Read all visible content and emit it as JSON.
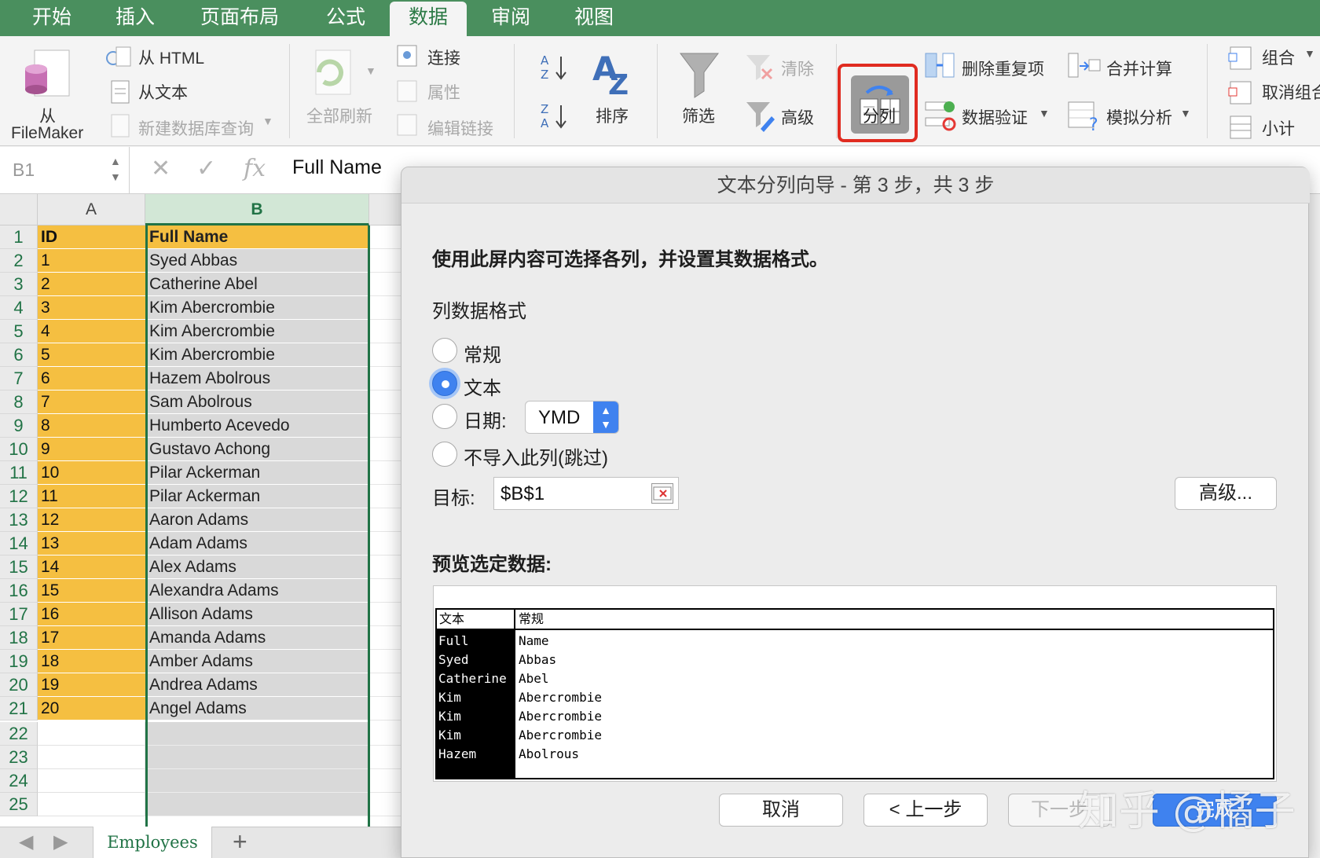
{
  "ribbon": {
    "tabs": [
      "开始",
      "插入",
      "页面布局",
      "公式",
      "数据",
      "审阅",
      "视图"
    ],
    "active_tab": "数据",
    "groups": {
      "get_data": {
        "filemaker": "从",
        "filemaker2": "FileMaker",
        "html": "从 HTML",
        "text": "从文本",
        "new_query": "新建数据库查询"
      },
      "connections": {
        "refresh_all": "全部刷新",
        "connections": "连接",
        "properties": "属性",
        "edit_links": "编辑链接"
      },
      "sort_filter": {
        "sort": "排序",
        "filter": "筛选",
        "clear": "清除",
        "advanced": "高级"
      },
      "tools": {
        "text_to_columns": "分列",
        "remove_duplicates": "删除重复项",
        "data_validation": "数据验证",
        "consolidate": "合并计算",
        "what_if": "模拟分析"
      },
      "outline": {
        "group": "组合",
        "ungroup": "取消组合",
        "subtotal": "小计"
      }
    }
  },
  "formula_bar": {
    "cell_ref": "B1",
    "value": "Full Name"
  },
  "grid": {
    "columns": [
      "A",
      "B"
    ],
    "rows": [
      {
        "n": "1",
        "a": "ID",
        "b": "Full Name"
      },
      {
        "n": "2",
        "a": "1",
        "b": "Syed Abbas"
      },
      {
        "n": "3",
        "a": "2",
        "b": "Catherine Abel"
      },
      {
        "n": "4",
        "a": "3",
        "b": "Kim Abercrombie"
      },
      {
        "n": "5",
        "a": "4",
        "b": "Kim Abercrombie"
      },
      {
        "n": "6",
        "a": "5",
        "b": "Kim Abercrombie"
      },
      {
        "n": "7",
        "a": "6",
        "b": "Hazem Abolrous"
      },
      {
        "n": "8",
        "a": "7",
        "b": "Sam Abolrous"
      },
      {
        "n": "9",
        "a": "8",
        "b": "Humberto Acevedo"
      },
      {
        "n": "10",
        "a": "9",
        "b": "Gustavo Achong"
      },
      {
        "n": "11",
        "a": "10",
        "b": "Pilar Ackerman"
      },
      {
        "n": "12",
        "a": "11",
        "b": "Pilar Ackerman"
      },
      {
        "n": "13",
        "a": "12",
        "b": "Aaron Adams"
      },
      {
        "n": "14",
        "a": "13",
        "b": "Adam Adams"
      },
      {
        "n": "15",
        "a": "14",
        "b": "Alex Adams"
      },
      {
        "n": "16",
        "a": "15",
        "b": "Alexandra Adams"
      },
      {
        "n": "17",
        "a": "16",
        "b": "Allison Adams"
      },
      {
        "n": "18",
        "a": "17",
        "b": "Amanda Adams"
      },
      {
        "n": "19",
        "a": "18",
        "b": "Amber Adams"
      },
      {
        "n": "20",
        "a": "19",
        "b": "Andrea Adams"
      },
      {
        "n": "21",
        "a": "20",
        "b": "Angel Adams"
      }
    ],
    "empty_rows": [
      "22",
      "23",
      "24",
      "25"
    ]
  },
  "sheet_tab": "Employees",
  "dialog": {
    "title": "文本分列向导 - 第 3 步，共 3 步",
    "instruction": "使用此屏内容可选择各列，并设置其数据格式。",
    "format_label": "列数据格式",
    "options": [
      "常规",
      "文本",
      "日期:",
      "不导入此列(跳过)"
    ],
    "selected_option": "文本",
    "date_format": "YMD",
    "target_label": "目标:",
    "target_value": "$B$1",
    "advanced_button": "高级...",
    "preview_label": "预览选定数据:",
    "preview": {
      "headers": [
        "文本",
        "常规"
      ],
      "rows": [
        [
          "Full",
          "Name"
        ],
        [
          "Syed",
          "Abbas"
        ],
        [
          "Catherine",
          "Abel"
        ],
        [
          "Kim",
          "Abercrombie"
        ],
        [
          "Kim",
          "Abercrombie"
        ],
        [
          "Kim",
          "Abercrombie"
        ],
        [
          "Hazem",
          "Abolrous"
        ]
      ]
    },
    "buttons": {
      "cancel": "取消",
      "back": "< 上一步",
      "next": "下一步",
      "finish": "完成"
    }
  },
  "watermark": "知乎 @橘子",
  "colors": {
    "excel_green": "#217346",
    "tab_green": "#4a8f5e",
    "id_fill": "#f5bf41",
    "highlight_red": "#e02b20",
    "primary_blue": "#3f82ef"
  }
}
